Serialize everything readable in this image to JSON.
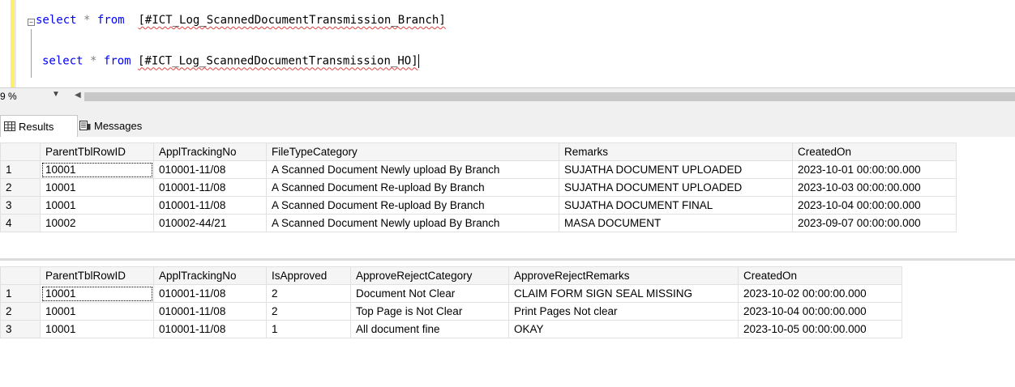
{
  "editor": {
    "line1": {
      "kw1": "select",
      "star": "*",
      "kw2": "from",
      "table": "[#ICT_Log_ScannedDocumentTransmission_Branch]"
    },
    "line2": {
      "kw1": "select",
      "star": "*",
      "kw2": "from",
      "table": "[#ICT_Log_ScannedDocumentTransmission_HO]"
    }
  },
  "zoom": {
    "value": "9 %"
  },
  "tabs": {
    "results": "Results",
    "messages": "Messages"
  },
  "grid1": {
    "headers": [
      "ParentTblRowID",
      "ApplTrackingNo",
      "FileTypeCategory",
      "Remarks",
      "CreatedOn"
    ],
    "rows": [
      [
        "1",
        "10001",
        "010001-11/08",
        "A Scanned Document Newly upload By Branch",
        "SUJATHA DOCUMENT UPLOADED",
        "2023-10-01 00:00:00.000"
      ],
      [
        "2",
        "10001",
        "010001-11/08",
        "A Scanned Document Re-upload By Branch",
        "SUJATHA DOCUMENT UPLOADED",
        "2023-10-03 00:00:00.000"
      ],
      [
        "3",
        "10001",
        "010001-11/08",
        "A Scanned Document Re-upload By Branch",
        "SUJATHA DOCUMENT FINAL",
        "2023-10-04 00:00:00.000"
      ],
      [
        "4",
        "10002",
        "010002-44/21",
        "A Scanned Document Newly upload By Branch",
        "MASA DOCUMENT",
        "2023-09-07 00:00:00.000"
      ]
    ]
  },
  "grid2": {
    "headers": [
      "ParentTblRowID",
      "ApplTrackingNo",
      "IsApproved",
      "ApproveRejectCategory",
      "ApproveRejectRemarks",
      "CreatedOn"
    ],
    "rows": [
      [
        "1",
        "10001",
        "010001-11/08",
        "2",
        "Document Not Clear",
        "CLAIM FORM SIGN SEAL MISSING",
        "2023-10-02 00:00:00.000"
      ],
      [
        "2",
        "10001",
        "010001-11/08",
        "2",
        "Top Page is Not Clear",
        "Print Pages Not clear",
        "2023-10-04 00:00:00.000"
      ],
      [
        "3",
        "10001",
        "010001-11/08",
        "1",
        "All document fine",
        "OKAY",
        "2023-10-05 00:00:00.000"
      ]
    ]
  }
}
